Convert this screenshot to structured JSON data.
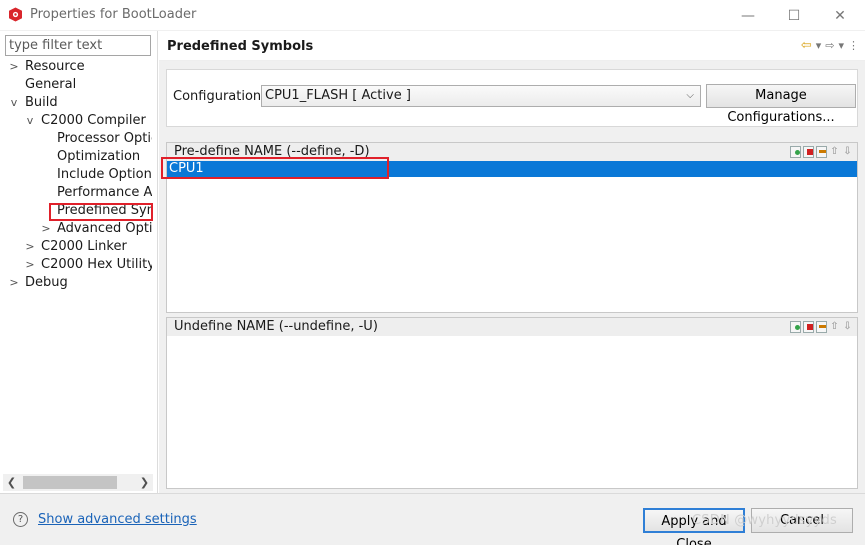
{
  "window": {
    "title": "Properties for BootLoader",
    "minimize_glyph": "—",
    "maximize_glyph": "☐",
    "close_glyph": "✕"
  },
  "sidebar": {
    "filter_placeholder": "type filter text",
    "items": [
      {
        "label": "Resource",
        "expander": ">"
      },
      {
        "label": "General",
        "expander": ""
      },
      {
        "label": "Build",
        "expander": "v"
      },
      {
        "label": "C2000 Compiler",
        "expander": "v"
      },
      {
        "label": "Processor Optio",
        "expander": ""
      },
      {
        "label": "Optimization",
        "expander": ""
      },
      {
        "label": "Include Options",
        "expander": ""
      },
      {
        "label": "Performance Ad",
        "expander": ""
      },
      {
        "label": "Predefined Syml",
        "expander": "",
        "selected": true
      },
      {
        "label": "Advanced Optic",
        "expander": ">"
      },
      {
        "label": "C2000 Linker",
        "expander": ">"
      },
      {
        "label": "C2000 Hex Utility",
        "expander": ">"
      },
      {
        "label": "Debug",
        "expander": ">"
      }
    ]
  },
  "main": {
    "title": "Predefined Symbols",
    "config_label": "Configuration:",
    "config_value": "CPU1_FLASH  [ Active ]",
    "manage_button": "Manage Configurations...",
    "predefine": {
      "header": "Pre-define NAME (--define, -D)",
      "rows": [
        "CPU1"
      ]
    },
    "undefine": {
      "header": "Undefine NAME (--undefine, -U)",
      "rows": []
    }
  },
  "footer": {
    "help_glyph": "?",
    "advanced_link": "Show advanced settings",
    "apply_button": "Apply and Close",
    "cancel_button": "Cancel",
    "watermark": "CSDN @wyhyydsyyds"
  },
  "colors": {
    "selection_blue": "#0a78d7",
    "highlight_red": "#e0202a",
    "link_blue": "#1a63b8"
  }
}
